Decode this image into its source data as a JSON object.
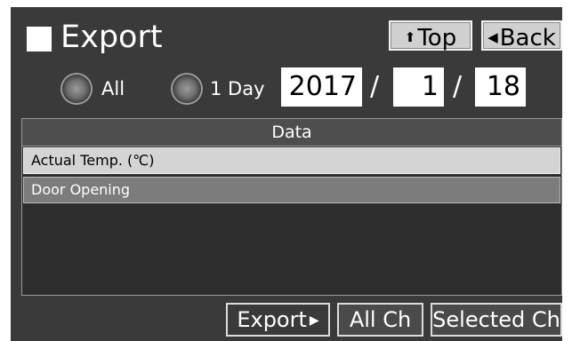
{
  "header": {
    "title": "Export",
    "top_label": "Top",
    "back_label": "Back"
  },
  "range": {
    "options": [
      {
        "label": "All"
      },
      {
        "label": "1 Day"
      }
    ]
  },
  "date": {
    "year": "2017",
    "month": "1",
    "day": "18",
    "separator": "/"
  },
  "table": {
    "header": "Data",
    "rows": [
      {
        "label": "Actual Temp. (℃)"
      },
      {
        "label": "Door Opening"
      }
    ]
  },
  "actions": {
    "export_label": "Export",
    "all_ch_label": "All Ch",
    "selected_ch_label": "Selected Ch"
  },
  "icons": {
    "title": "square-icon",
    "top": "up-arrow-icon",
    "back": "left-arrow-icon",
    "export": "right-arrow-icon"
  },
  "colors": {
    "background": "#3a3a3a",
    "button_face": "#d0d0d0",
    "selected_row": "#d4d4d4",
    "second_row": "#7c7c7c"
  }
}
